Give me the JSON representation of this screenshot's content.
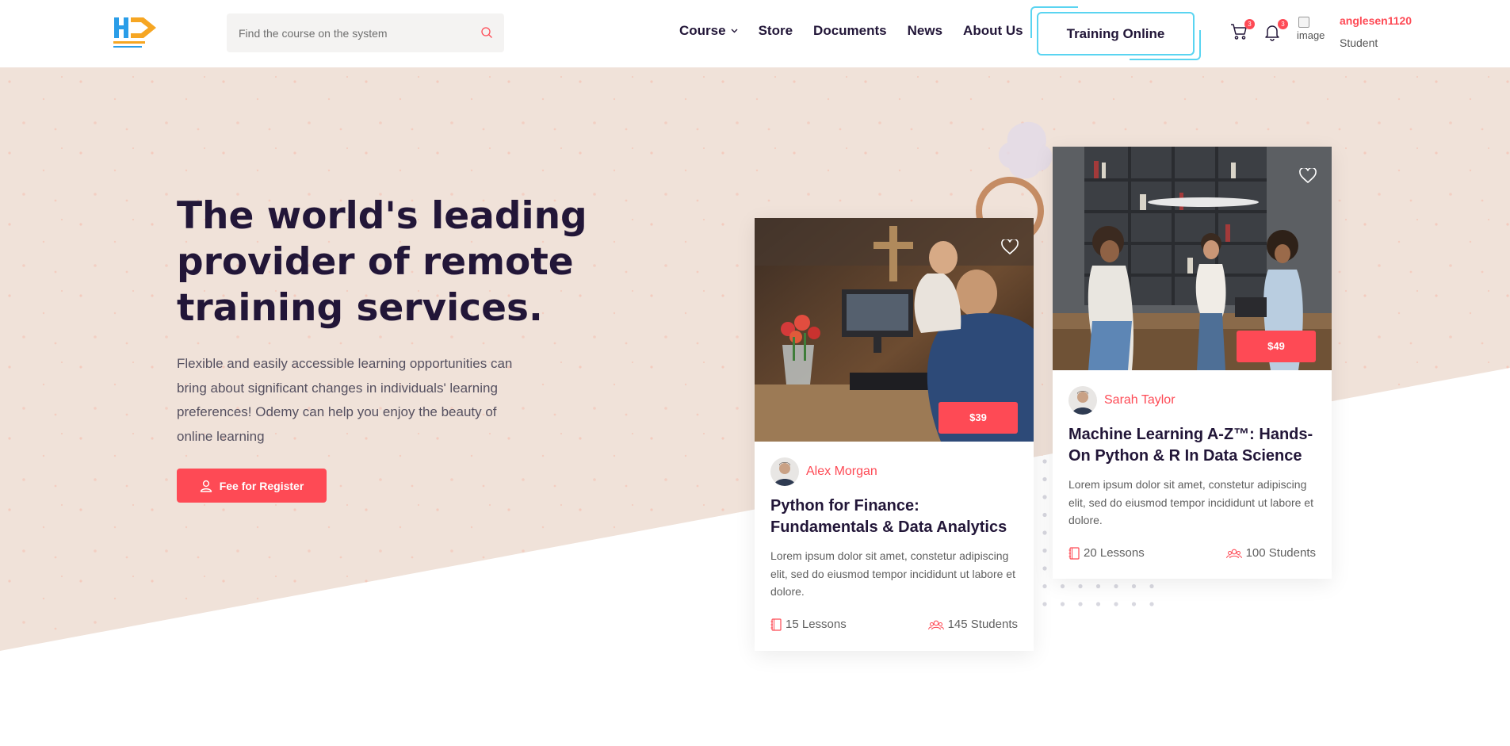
{
  "header": {
    "logo_text": "Hue Dung",
    "search": {
      "placeholder": "Find the course on the system",
      "icon": "search-icon"
    },
    "nav": [
      {
        "label": "Course",
        "has_dropdown": true
      },
      {
        "label": "Store"
      },
      {
        "label": "Documents"
      },
      {
        "label": "News"
      },
      {
        "label": "About Us"
      }
    ],
    "training_button": "Training Online",
    "cart": {
      "icon": "cart-icon",
      "count": "3"
    },
    "notifications": {
      "icon": "bell-icon",
      "count": "3"
    },
    "avatar_alt": "image",
    "username": "anglesen1120",
    "role": "Student"
  },
  "hero": {
    "title_lines": [
      "The world's leading",
      "provider of remote",
      "training services."
    ],
    "description": "Flexible and easily accessible learning opportunities can bring about significant changes in individuals' learning preferences! Odemy can help you enjoy the beauty of online learning",
    "register_button": "Fee for Register",
    "register_icon": "user-icon"
  },
  "courses": [
    {
      "price": "$39",
      "author": "Alex Morgan",
      "title": "Python for Finance: Fundamentals & Data Analytics",
      "description": "Lorem ipsum dolor sit amet, constetur adipiscing elit, sed do eiusmod tempor incididunt ut labore et dolore.",
      "lessons": "15 Lessons",
      "students": "145 Students"
    },
    {
      "price": "$49",
      "author": "Sarah Taylor",
      "title": "Machine Learning A-Z™: Hands-On Python & R In Data Science",
      "description": "Lorem ipsum dolor sit amet, constetur adipiscing elit, sed do eiusmod tempor incididunt ut labore et dolore.",
      "lessons": "20 Lessons",
      "students": "100 Students"
    }
  ],
  "colors": {
    "accent": "#fe4a55",
    "hero_bg": "#f0e2d9",
    "heading": "#221638",
    "training_border": "#5ad4f1"
  }
}
